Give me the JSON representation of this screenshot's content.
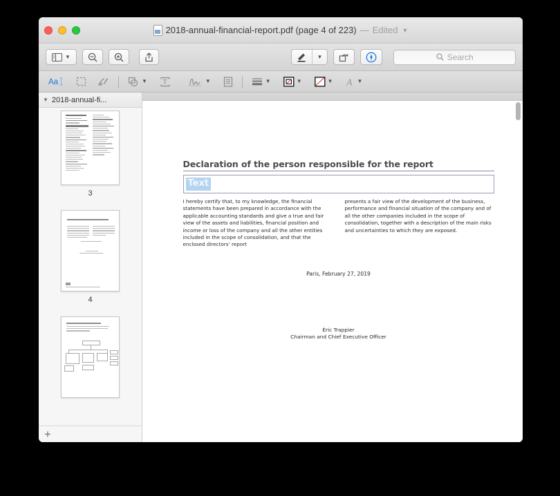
{
  "window": {
    "traffic_lights": [
      "close",
      "minimize",
      "maximize"
    ],
    "title": "2018-annual-financial-report.pdf (page 4 of 223)",
    "title_separator": "—",
    "edited_label": "Edited",
    "doc_icon": "pdf-document-icon"
  },
  "toolbar": {
    "sidebar_toggle": "sidebar-icon",
    "zoom_out": "zoom-out-icon",
    "zoom_in": "zoom-in-icon",
    "share": "share-icon",
    "markup_pen": "markup-pen-icon",
    "markup_dropdown": "chevron-down-icon",
    "rotate": "rotate-icon",
    "annotate_toggle": "annotate-pen-circle-icon",
    "search_placeholder": "Search",
    "search_value": "",
    "search_icon": "search-icon"
  },
  "annotation_bar": {
    "tools": [
      {
        "name": "text-selection-tool",
        "glyph": "AaI",
        "active": true
      },
      {
        "name": "rectangular-selection-tool",
        "glyph": "dashed-rect"
      },
      {
        "name": "sketch-tool",
        "glyph": "sketch"
      },
      {
        "name": "shapes-tool",
        "glyph": "shapes",
        "has_dropdown": true
      },
      {
        "name": "text-box-tool",
        "glyph": "textbox"
      },
      {
        "name": "signature-tool",
        "glyph": "signature",
        "has_dropdown": true
      },
      {
        "name": "note-tool",
        "glyph": "note"
      },
      {
        "name": "line-style-tool",
        "glyph": "lines",
        "has_dropdown": true
      },
      {
        "name": "border-color-tool",
        "glyph": "border-swatch",
        "has_dropdown": true
      },
      {
        "name": "fill-color-tool",
        "glyph": "fill-swatch-none",
        "has_dropdown": true
      },
      {
        "name": "font-style-tool",
        "glyph": "A",
        "has_dropdown": true
      }
    ]
  },
  "sidebar": {
    "disclosure_icon": "chevron-down-icon",
    "title": "2018-annual-fi...",
    "thumbnails": [
      {
        "page_number": "3",
        "kind": "two-column-toc"
      },
      {
        "page_number": "4",
        "kind": "declaration-page"
      },
      {
        "page_number": "",
        "kind": "org-chart-page"
      }
    ],
    "add_page_label": "+"
  },
  "document": {
    "heading": "Declaration of the person responsible for the report",
    "annotation_textbox": {
      "value": "Text",
      "selected": true,
      "highlight_color": "#b3d4f0"
    },
    "column_left": [
      "I hereby certify that, to my knowledge, the financial statements have been prepared in accordance with the applicable accounting standards and give a true and fair view of the assets and liabilities, financial position and income or loss of the company and all the other entities included in the scope of consolidation, and that the enclosed directors’ report"
    ],
    "column_right": [
      "presents a fair view of the development of the business, performance and financial situation of the company and of all the other companies included in the scope of consolidation, together with a description of the main risks and uncertainties to which they are exposed."
    ],
    "place_date": "Paris, February 27, 2019",
    "signer_name": "Éric Trappier",
    "signer_title": "Chairman and Chief Executive Officer"
  },
  "colors": {
    "selection_blue": "#b3d4f0",
    "accent_blue": "#1e76d8",
    "annotate_active": "#1a79e0",
    "swatch_red": "#d63b2f",
    "window_chrome": "#d8d8d8"
  }
}
